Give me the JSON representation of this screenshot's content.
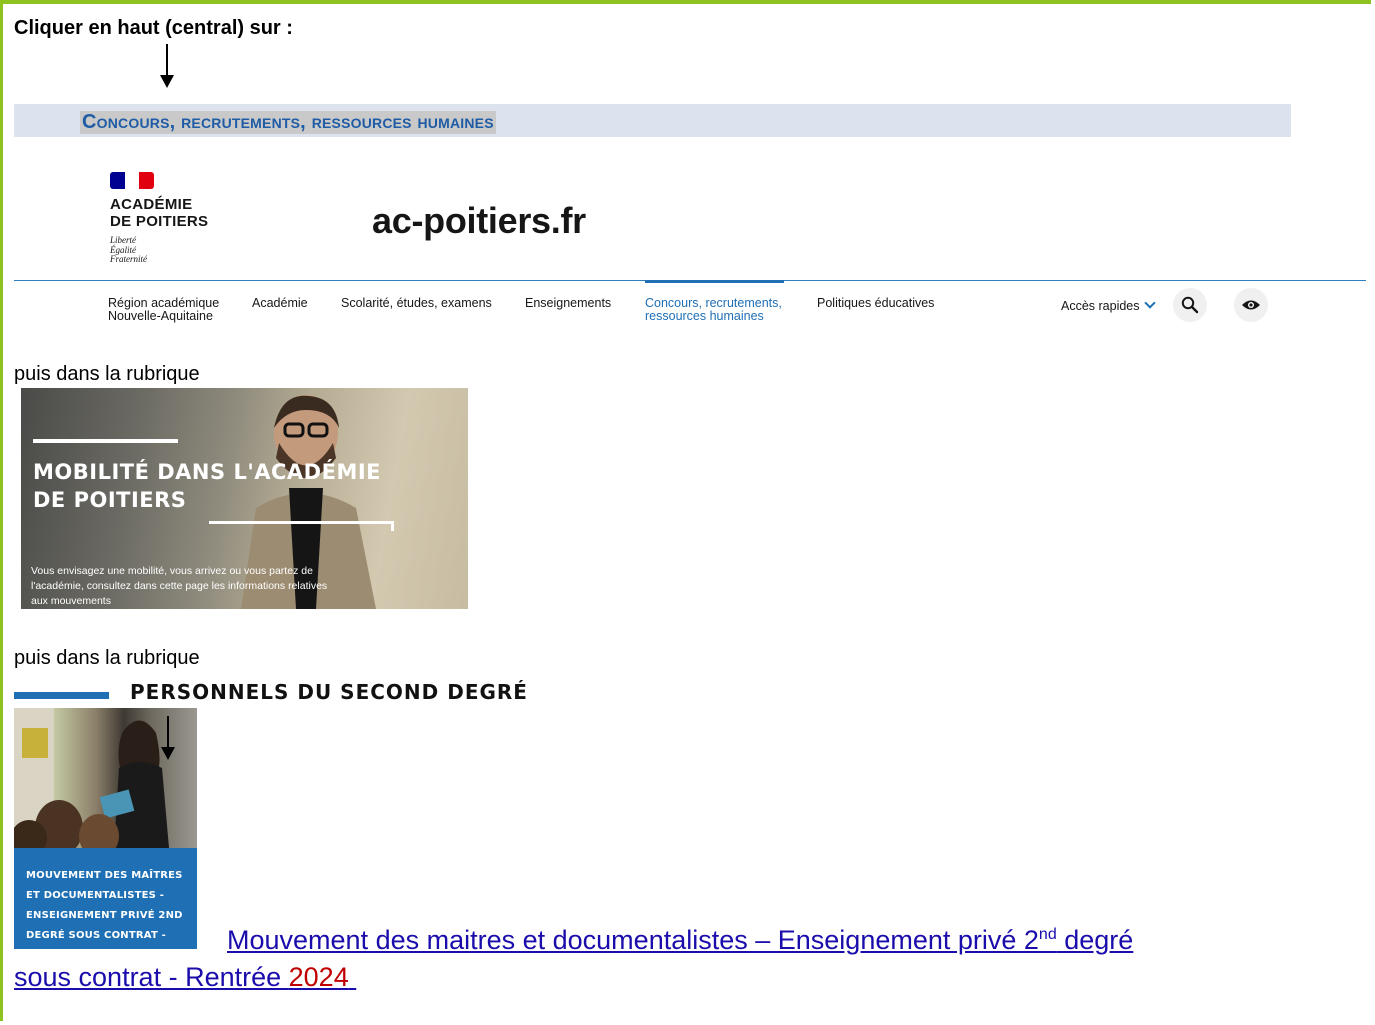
{
  "instruction": "Cliquer en haut (central) sur :",
  "band_link": "Concours, recrutements, ressources humaines",
  "header": {
    "academy_line1": "ACADÉMIE",
    "academy_line2": "DE POITIERS",
    "motto": [
      "Liberté",
      "Égalité",
      "Fraternité"
    ],
    "site_name": "ac-poitiers.fr",
    "flag_colors": [
      "#000091",
      "#ffffff",
      "#e1000f"
    ]
  },
  "nav": {
    "items": [
      {
        "line1": "Région académique",
        "line2": "Nouvelle-Aquitaine"
      },
      {
        "line1": "Académie",
        "line2": ""
      },
      {
        "line1": "Scolarité, études, examens",
        "line2": ""
      },
      {
        "line1": "Enseignements",
        "line2": ""
      },
      {
        "line1": "Concours, recrutements,",
        "line2": "ressources humaines",
        "active": true
      },
      {
        "line1": "Politiques éducatives",
        "line2": ""
      }
    ],
    "quick_access": "Accès rapides",
    "icons": [
      "chevron-down-icon",
      "search-icon",
      "eye-icon"
    ],
    "accent": "#1f6fb5"
  },
  "step2_label": "puis dans la rubrique",
  "mobility": {
    "title_line1": "MOBILITÉ DANS L'ACADÉMIE",
    "title_line2": "DE POITIERS",
    "desc_line1": "Vous envisagez une mobilité, vous arrivez ou vous partez de",
    "desc_line2": "l'académie, consultez dans cette page les informations relatives",
    "desc_line3": "aux mouvements"
  },
  "step3_label": "puis dans la rubrique",
  "section_title": "PERSONNELS DU SECOND DEGRÉ",
  "thumbnail": {
    "line1": "MOUVEMENT DES MAÎTRES",
    "line2": "ET DOCUMENTALISTES -",
    "line3": "ENSEIGNEMENT PRIVÉ 2ND",
    "line4": "DEGRÉ SOUS CONTRAT -"
  },
  "link": {
    "part1": "Mouvement des maitres et documentalistes – Enseignement privé 2",
    "sup": "nd",
    "part2": " degré",
    "part3": "sous contrat - Rentrée ",
    "year": "2024"
  }
}
